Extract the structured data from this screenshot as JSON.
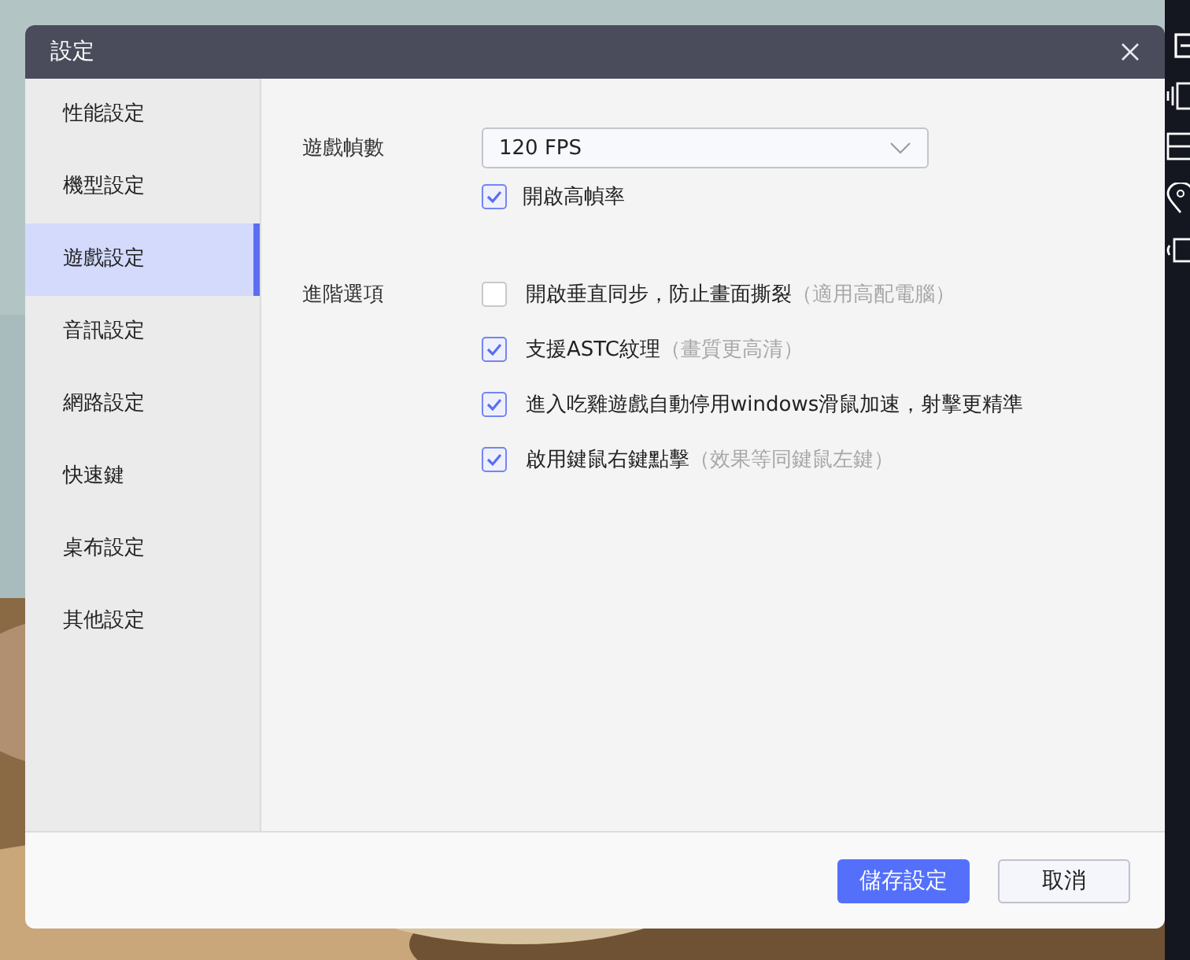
{
  "window": {
    "title": "設定"
  },
  "sidebar": {
    "items": [
      {
        "label": "性能設定",
        "selected": false
      },
      {
        "label": "機型設定",
        "selected": false
      },
      {
        "label": "遊戲設定",
        "selected": true
      },
      {
        "label": "音訊設定",
        "selected": false
      },
      {
        "label": "網路設定",
        "selected": false
      },
      {
        "label": "快速鍵",
        "selected": false
      },
      {
        "label": "桌布設定",
        "selected": false
      },
      {
        "label": "其他設定",
        "selected": false
      }
    ]
  },
  "frame_rate": {
    "label": "遊戲幀數",
    "value": "120 FPS"
  },
  "high_frame_rate": {
    "label": "開啟高幀率",
    "checked": true
  },
  "advanced": {
    "label": "進階選項",
    "options": [
      {
        "label": "開啟垂直同步，防止畫面撕裂",
        "note": "（適用高配電腦）",
        "checked": false
      },
      {
        "label": "支援ASTC紋理",
        "note": "（畫質更高清）",
        "checked": true
      },
      {
        "label": "進入吃雞遊戲自動停用windows滑鼠加速，射擊更精準",
        "checked": true
      },
      {
        "label": "啟用鍵鼠右鍵點擊",
        "note": "（效果等同鍵鼠左鍵）",
        "checked": true
      }
    ]
  },
  "buttons": [
    {
      "label": "儲存設定",
      "kind": "primary"
    },
    {
      "label": "取消",
      "kind": "secondary"
    }
  ]
}
